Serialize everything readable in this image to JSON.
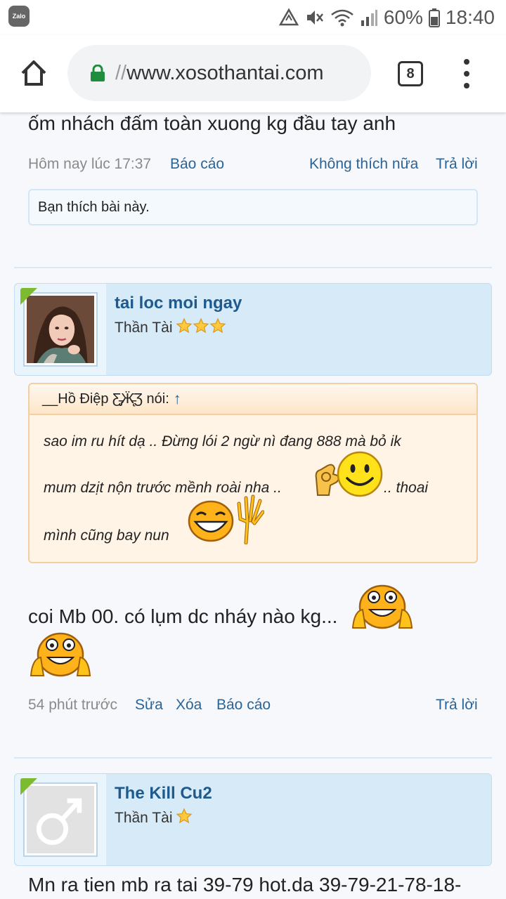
{
  "status_bar": {
    "app_icon_label": "Zalo",
    "battery_percent": "60%",
    "time": "18:40",
    "icons": [
      "recycle-icon",
      "mute-icon",
      "wifi-icon",
      "signal-icon",
      "battery-icon"
    ]
  },
  "browser": {
    "url_prefix": "//",
    "url": "www.xosothantai.com",
    "tab_count": "8"
  },
  "post_prev": {
    "text_tail": "ốm nhách đấm toàn xuong kg đầu tay anh",
    "time": "Hôm nay lúc 17:37",
    "report": "Báo cáo",
    "unlike": "Không thích nữa",
    "reply": "Trả lời",
    "liked_notice": "Bạn thích bài này."
  },
  "post_main": {
    "username": "tai loc moi ngay",
    "user_title": "Thần Tài",
    "stars": 3,
    "quote_author": "__Hồ Điệp Ƹ̵̡Ӝ̵̨̄Ʒ nói:",
    "quote_arrow": "↑",
    "quote_line1": "sao im ru hít dạ .. Đừng lói 2 ngừ nì đang 888 mà bỏ ik",
    "quote_line2a": "mum dzịt nộn trước mềnh roài nha ..",
    "quote_line2b": ".. thoai",
    "quote_line3": "mình cũng bay nun",
    "body_text": "coi Mb 00. có lụm dc nháy nào kg...",
    "time": "54 phút trước",
    "edit": "Sửa",
    "delete": "Xóa",
    "report": "Báo cáo",
    "reply": "Trả lời"
  },
  "post_next": {
    "username": "The Kill Cu2",
    "user_title": "Thần Tài",
    "stars": 1,
    "body_text": "Mn ra tien mb ra tai 39-79 hot.da 39-79-21-78-18-"
  },
  "colors": {
    "link": "#2a6496",
    "username": "#1f5a8c",
    "user_card_bg": "#d6eaf8",
    "quote_bg": "#fff4e6",
    "badge_green": "#7cbb2f"
  }
}
